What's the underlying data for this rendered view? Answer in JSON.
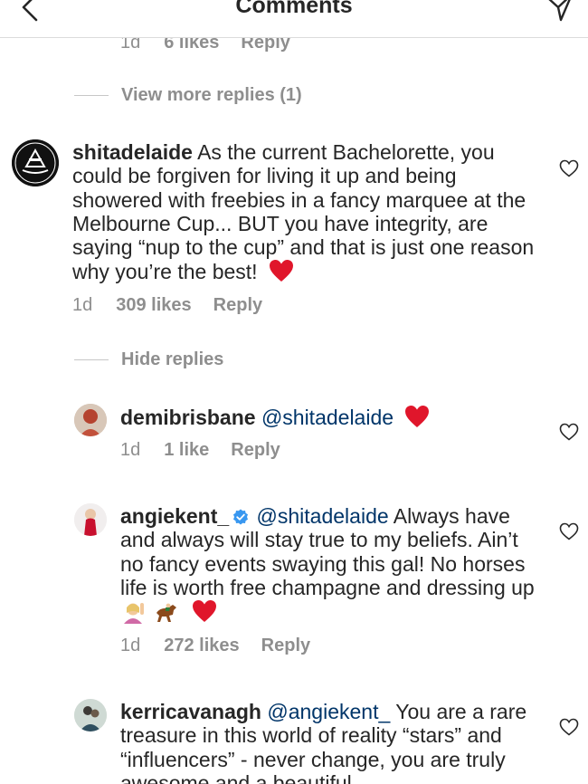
{
  "header": {
    "title": "Comments",
    "back_icon": "chevron-left-icon",
    "send_icon": "send-icon"
  },
  "top_comment_meta": {
    "time": "1d",
    "likes": "6 likes",
    "reply": "Reply"
  },
  "view_more": {
    "label": "View more replies (1)"
  },
  "comments": [
    {
      "username": "shitadelaide",
      "text": "As the current Bachelorette, you could be forgiven for living it up and being showered with freebies in a fancy marquee at the Melbourne Cup... BUT you have integrity, are saying “nup to the cup” and that is just one reason why you’re the best!",
      "time": "1d",
      "likes": "309 likes",
      "reply": "Reply",
      "emojis": [
        "red-heart"
      ]
    }
  ],
  "hide_replies": {
    "label": "Hide replies"
  },
  "replies": [
    {
      "username": "demibrisbane",
      "mention": "@shitadelaide",
      "text": "",
      "time": "1d",
      "likes": "1 like",
      "reply": "Reply",
      "emojis": [
        "red-heart"
      ]
    },
    {
      "username": "angiekent_",
      "verified": true,
      "mention": "@shitadelaide",
      "text": "Always have and always will stay true to my beliefs. Ain’t no fancy events swaying this gal! No horses life is worth free champagne and dressing up",
      "time": "1d",
      "likes": "272 likes",
      "reply": "Reply",
      "emojis": [
        "woman-raising-hand",
        "horse",
        "red-heart"
      ]
    },
    {
      "username": "kerricavanagh",
      "mention": "@angiekent_",
      "text": "You are a rare treasure in this world of reality “stars” and “influencers” - never change, you are truly awesome and a beautiful"
    }
  ],
  "colors": {
    "text": "#262626",
    "secondary": "#8e8e8e",
    "mention": "#003569",
    "heart": "#e0162b",
    "divider": "#dbdbdb"
  }
}
